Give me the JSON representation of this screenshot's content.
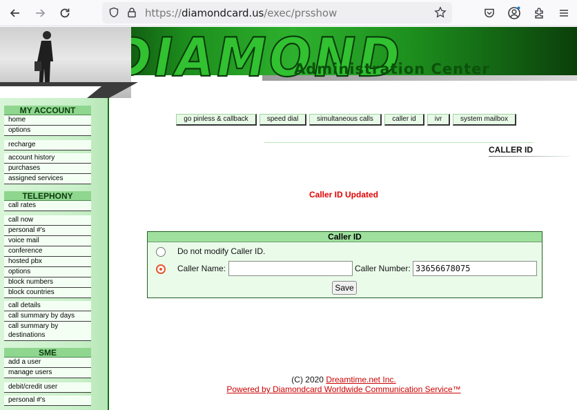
{
  "browser": {
    "url_scheme": "https://",
    "url_host": "diamondcard.us",
    "url_path": "/exec/prsshow"
  },
  "banner": {
    "logo_text": "DIAMOND",
    "title": "Administration Center"
  },
  "sidebar": {
    "account": {
      "heading": "MY ACCOUNT",
      "group1": [
        "home",
        "options"
      ],
      "group2": [
        "recharge"
      ],
      "group3": [
        "account history",
        "purchases",
        "assigned services"
      ]
    },
    "telephony": {
      "heading": "TELEPHONY",
      "group1": [
        "call rates"
      ],
      "group2": [
        "call now",
        "personal #'s",
        "voice mail",
        "conference",
        "hosted pbx",
        "options",
        "block numbers",
        "block countries"
      ],
      "group3": [
        "call details",
        "call summary by days",
        "call summary by destinations"
      ]
    },
    "sme": {
      "heading": "SME",
      "group1": [
        "add a user",
        "manage users"
      ],
      "group2": [
        "debit/credit user"
      ],
      "group3": [
        "personal #'s"
      ]
    }
  },
  "nav": {
    "buttons": [
      "go pinless & callback",
      "speed dial",
      "simultaneous calls",
      "caller id",
      "ivr",
      "system mailbox"
    ]
  },
  "section_title": "CALLER ID",
  "status_message": "Caller ID Updated",
  "form": {
    "heading": "Caller ID",
    "option_no_modify": "Do not modify Caller ID.",
    "caller_name_label": "Caller Name:",
    "caller_name_value": "",
    "caller_number_label": "Caller Number:",
    "caller_number_value": "33656678075",
    "selected_option": "set",
    "save_label": "Save"
  },
  "footer": {
    "copyright": "(C) 2020",
    "company_link": "Dreamtime.net Inc.",
    "powered_link": "Powered by Diamondcard Worldwide Communication Service™"
  },
  "colors": {
    "brand_green": "#1d8f1d",
    "status_red": "#e00000",
    "radio_accent": "#e8552e"
  }
}
